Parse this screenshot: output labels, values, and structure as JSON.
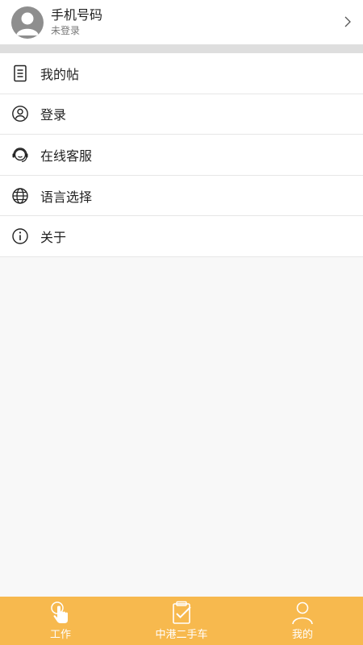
{
  "profile": {
    "name": "手机号码",
    "status": "未登录"
  },
  "menu": {
    "items": [
      {
        "label": "我的帖",
        "icon": "document-icon"
      },
      {
        "label": "登录",
        "icon": "user-circle-icon"
      },
      {
        "label": "在线客服",
        "icon": "headset-icon"
      },
      {
        "label": "语言选择",
        "icon": "globe-icon"
      },
      {
        "label": "关于",
        "icon": "info-icon"
      }
    ]
  },
  "tabbar": {
    "accent": "#f7b94e",
    "tabs": [
      {
        "label": "工作",
        "icon": "hand-tap-icon"
      },
      {
        "label": "中港二手车",
        "icon": "clipboard-check-icon"
      },
      {
        "label": "我的",
        "icon": "person-icon",
        "active": true
      }
    ]
  }
}
